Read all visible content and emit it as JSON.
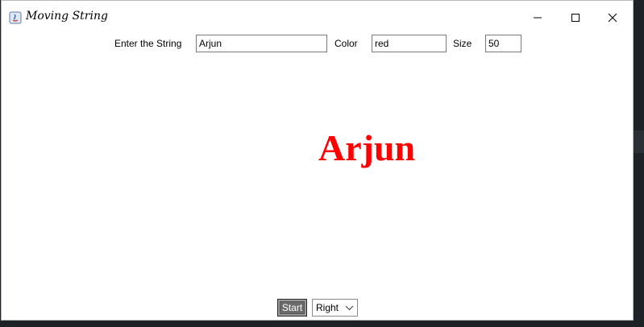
{
  "window": {
    "title": "Moving String"
  },
  "form": {
    "string_label": "Enter the String",
    "string_value": "Arjun",
    "color_label": "Color",
    "color_value": "red",
    "size_label": "Size",
    "size_value": "50"
  },
  "canvas": {
    "text": "Arjun",
    "text_color": "#ff0000"
  },
  "footer": {
    "start_label": "Start",
    "direction_value": "Right"
  },
  "icons": {
    "app": "java-app-icon",
    "minimize": "minimize-icon",
    "maximize": "maximize-icon",
    "close": "close-icon",
    "dropdown": "chevron-down-icon"
  }
}
